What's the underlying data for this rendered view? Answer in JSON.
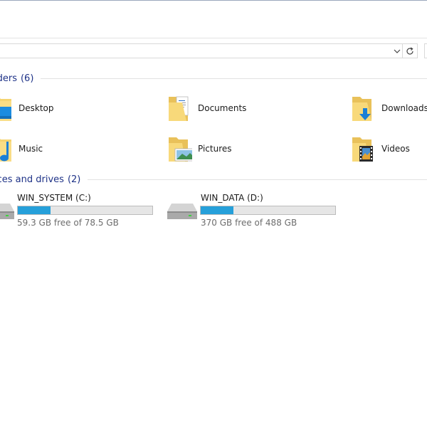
{
  "address_bar": {
    "dropdown_icon": "chevron-down-icon",
    "refresh_icon": "refresh-icon"
  },
  "folders_group": {
    "title": "lders",
    "count": "(6)",
    "items": [
      {
        "label": "Desktop",
        "icon": "desktop-folder-icon"
      },
      {
        "label": "Documents",
        "icon": "documents-folder-icon"
      },
      {
        "label": "Downloads",
        "icon": "downloads-folder-icon"
      },
      {
        "label": "Music",
        "icon": "music-folder-icon"
      },
      {
        "label": "Pictures",
        "icon": "pictures-folder-icon"
      },
      {
        "label": "Videos",
        "icon": "videos-folder-icon"
      }
    ]
  },
  "drives_group": {
    "title": "ices and drives",
    "count": "(2)",
    "items": [
      {
        "name": "WIN_SYSTEM (C:)",
        "free_text": "59.3 GB free of 78.5 GB",
        "used_fraction": 0.245,
        "icon": "hard-drive-icon"
      },
      {
        "name": "WIN_DATA (D:)",
        "free_text": "370 GB free of 488 GB",
        "used_fraction": 0.242,
        "icon": "hard-drive-icon"
      }
    ]
  },
  "colors": {
    "header_text": "#1e3287",
    "usage_bar": "#26a0da",
    "folder_yellow": "#f5d470"
  }
}
